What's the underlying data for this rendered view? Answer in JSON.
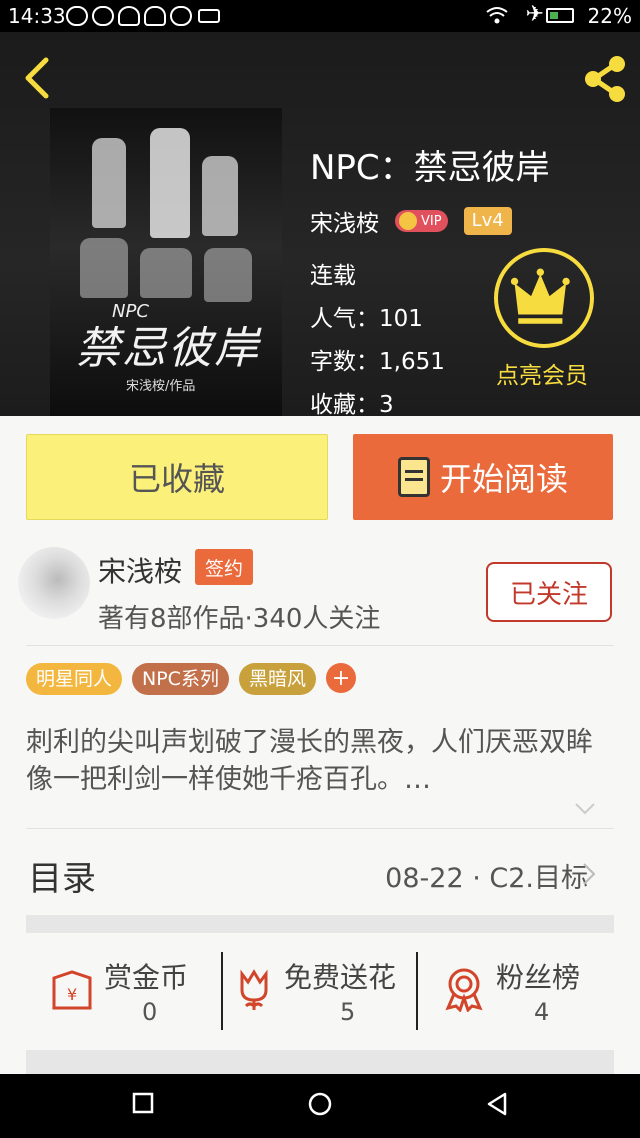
{
  "status_bar": {
    "time": "14:33",
    "battery": "22%"
  },
  "header": {
    "book_title": "NPC：禁忌彼岸",
    "author": "宋浅桉",
    "vip_label": "VIP",
    "level": "Lv4",
    "status": "连载",
    "popularity": "人气：101",
    "word_count": "字数：1,651",
    "favorites": "收藏：3",
    "vip_action": "点亮会员"
  },
  "cover": {
    "npc": "NPC",
    "title": "禁忌彼岸",
    "subtitle": "宋浅桉/作品"
  },
  "actions": {
    "collected": "已收藏",
    "read": "开始阅读"
  },
  "author_info": {
    "name": "宋浅桉",
    "badge": "签约",
    "stats": "著有8部作品·340人关注",
    "follow": "已关注"
  },
  "tags": [
    "明星同人",
    "NPC系列",
    "黑暗风"
  ],
  "tag_add": "+",
  "synopsis": "刺利的尖叫声划破了漫长的黑夜，人们厌恶双眸像一把利剑一样使她千疮百孔。…",
  "toc": {
    "label": "目录",
    "latest": "08-22 · C2.目标"
  },
  "stats": [
    {
      "label": "赏金币",
      "value": "0"
    },
    {
      "label": "免费送花",
      "value": "5"
    },
    {
      "label": "粉丝榜",
      "value": "4"
    }
  ],
  "colors": {
    "accent": "#ea6a3c",
    "collected_bg": "#fbf07a",
    "vip_gold": "#f7dc3f"
  }
}
